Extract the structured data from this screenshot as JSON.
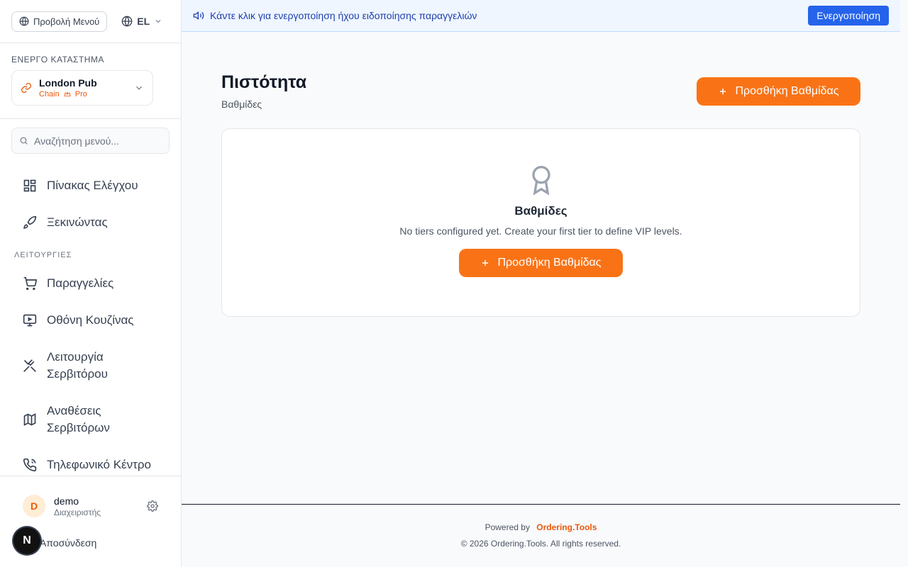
{
  "sidebar": {
    "menu_view_label": "Προβολή Μενού",
    "language": "EL",
    "store_section_label": "ΕΝΕΡΓΟ ΚΑΤΑΣΤΗΜΑ",
    "store": {
      "name": "London Pub",
      "type": "Chain",
      "plan": "Pro"
    },
    "search": {
      "placeholder": "Αναζήτηση μενού..."
    },
    "items_top": [
      {
        "label": "Πίνακας Ελέγχου",
        "icon": "dashboard-icon"
      },
      {
        "label": "Ξεκινώντας",
        "icon": "rocket-icon"
      }
    ],
    "group_label": "ΛΕΙΤΟΥΡΓΙΕΣ",
    "items_ops": [
      {
        "label": "Παραγγελίες",
        "icon": "cart-icon"
      },
      {
        "label": "Οθόνη Κουζίνας",
        "icon": "monitor-icon"
      },
      {
        "label": "Λειτουργία Σερβιτόρου",
        "icon": "utensils-icon"
      },
      {
        "label": "Αναθέσεις Σερβιτόρων",
        "icon": "map-icon"
      },
      {
        "label": "Τηλεφωνικό Κέντρο",
        "icon": "phone-icon"
      }
    ],
    "user": {
      "initial": "D",
      "name": "demo",
      "role": "Διαχειριστής"
    },
    "logout_label": "Αποσύνδεση",
    "badge_letter": "N"
  },
  "banner": {
    "text": "Κάντε κλικ για ενεργοποίηση ήχου ειδοποίησης παραγγελιών",
    "button_label": "Ενεργοποίηση"
  },
  "page": {
    "title": "Πιστότητα",
    "subtitle": "Βαθμίδες",
    "add_button_label": "Προσθήκη Βαθμίδας"
  },
  "empty_state": {
    "title": "Βαθμίδες",
    "description": "No tiers configured yet. Create your first tier to define VIP levels.",
    "button_label": "Προσθήκη Βαθμίδας"
  },
  "footer": {
    "powered_by": "Powered by",
    "brand": "Ordering.Tools",
    "copyright": "© 2026 Ordering.Tools. All rights reserved."
  },
  "colors": {
    "accent": "#f97316",
    "banner_button": "#2563eb"
  }
}
